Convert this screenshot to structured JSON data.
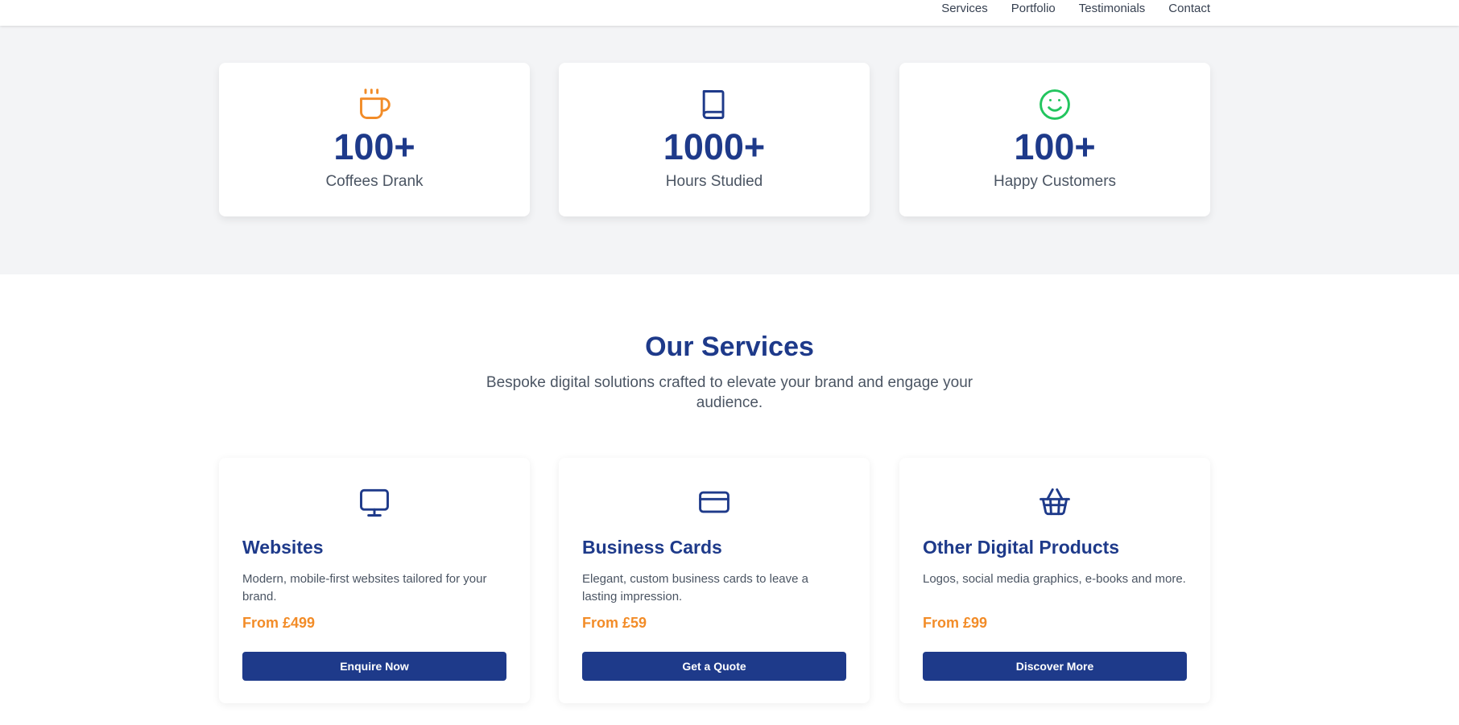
{
  "nav": {
    "links": [
      "Services",
      "Portfolio",
      "Testimonials",
      "Contact"
    ]
  },
  "stats": [
    {
      "icon": "coffee-cup-icon",
      "value": "100+",
      "label": "Coffees Drank",
      "color": "#f28c28"
    },
    {
      "icon": "book-icon",
      "value": "1000+",
      "label": "Hours Studied",
      "color": "#1e3a8a"
    },
    {
      "icon": "smiley-face-icon",
      "value": "100+",
      "label": "Happy Customers",
      "color": "#22c55e"
    }
  ],
  "services": {
    "title": "Our Services",
    "subtitle": "Bespoke digital solutions crafted to elevate your brand and engage your audience.",
    "cards": [
      {
        "icon": "monitor-icon",
        "title": "Websites",
        "description": "Modern, mobile-first websites tailored for your brand.",
        "price": "From £499",
        "button": "Enquire Now"
      },
      {
        "icon": "credit-card-icon",
        "title": "Business Cards",
        "description": "Elegant, custom business cards to leave a lasting impression.",
        "price": "From £59",
        "button": "Get a Quote"
      },
      {
        "icon": "shopping-basket-icon",
        "title": "Other Digital Products",
        "description": "Logos, social media graphics, e-books and more.",
        "price": "From £99",
        "button": "Discover More"
      }
    ]
  },
  "colors": {
    "primary": "#1e3a8a",
    "accent": "#f28c28",
    "success": "#22c55e",
    "section_bg": "#f3f4f6"
  }
}
